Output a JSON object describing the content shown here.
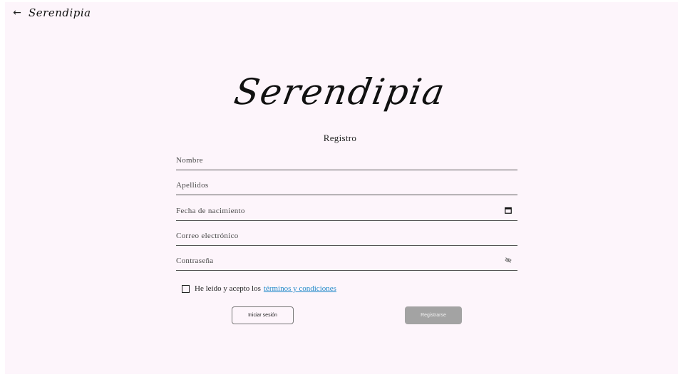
{
  "header": {
    "back_icon": "arrow-left-icon",
    "brand": "Serendipia"
  },
  "logo": "Serendipia",
  "form": {
    "title": "Registro",
    "fields": {
      "nombre": "Nombre",
      "apellidos": "Apellidos",
      "fecha": "Fecha de nacimiento",
      "correo": "Correo electrónico",
      "contrasena": "Contraseña"
    },
    "icons": {
      "date": "calendar-icon",
      "password": "eye-off-icon"
    },
    "terms_text": "He leído y acepto los",
    "terms_link": "términos y condiciones",
    "login_button": "Iniciar sesión",
    "register_button": "Registrarse"
  },
  "colors": {
    "background": "#fdf5fb",
    "link": "#1e88c8",
    "register_button_disabled": "#a3a3a3"
  }
}
